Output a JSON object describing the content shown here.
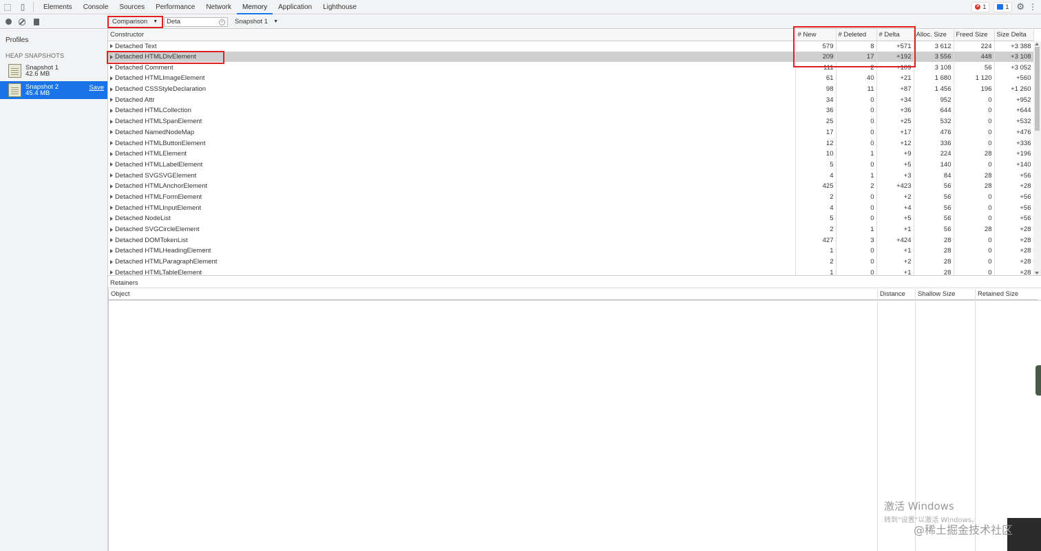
{
  "devtools": {
    "tabs": [
      "Elements",
      "Console",
      "Sources",
      "Performance",
      "Network",
      "Memory",
      "Application",
      "Lighthouse"
    ],
    "selected_tab": "Memory",
    "error_count": "1",
    "message_count": "1"
  },
  "profiles": {
    "title": "Profiles",
    "section": "HEAP SNAPSHOTS",
    "snapshots": [
      {
        "name": "Snapshot 1",
        "size": "42.6 MB"
      },
      {
        "name": "Snapshot 2",
        "size": "45.4 MB",
        "action": "Save"
      }
    ]
  },
  "toolbar": {
    "view_mode": "Comparison",
    "filter_value": "Deta",
    "compare_to": "Snapshot 1"
  },
  "grid": {
    "columns": [
      "Constructor",
      "# New",
      "# Deleted",
      "# Delta",
      "Alloc. Size",
      "Freed Size",
      "Size Delta"
    ],
    "selected_row": 1,
    "rows": [
      [
        "Detached Text",
        "579",
        "8",
        "+571",
        "3 612",
        "224",
        "+3 388"
      ],
      [
        "Detached HTMLDivElement",
        "209",
        "17",
        "+192",
        "3 556",
        "448",
        "+3 108"
      ],
      [
        "Detached Comment",
        "111",
        "2",
        "+109",
        "3 108",
        "56",
        "+3 052"
      ],
      [
        "Detached HTMLImageElement",
        "61",
        "40",
        "+21",
        "1 680",
        "1 120",
        "+560"
      ],
      [
        "Detached CSSStyleDeclaration",
        "98",
        "11",
        "+87",
        "1 456",
        "196",
        "+1 260"
      ],
      [
        "Detached Attr",
        "34",
        "0",
        "+34",
        "952",
        "0",
        "+952"
      ],
      [
        "Detached HTMLCollection",
        "36",
        "0",
        "+36",
        "644",
        "0",
        "+644"
      ],
      [
        "Detached HTMLSpanElement",
        "25",
        "0",
        "+25",
        "532",
        "0",
        "+532"
      ],
      [
        "Detached NamedNodeMap",
        "17",
        "0",
        "+17",
        "476",
        "0",
        "+476"
      ],
      [
        "Detached HTMLButtonElement",
        "12",
        "0",
        "+12",
        "336",
        "0",
        "+336"
      ],
      [
        "Detached HTMLElement",
        "10",
        "1",
        "+9",
        "224",
        "28",
        "+196"
      ],
      [
        "Detached HTMLLabelElement",
        "5",
        "0",
        "+5",
        "140",
        "0",
        "+140"
      ],
      [
        "Detached SVGSVGElement",
        "4",
        "1",
        "+3",
        "84",
        "28",
        "+56"
      ],
      [
        "Detached HTMLAnchorElement",
        "425",
        "2",
        "+423",
        "56",
        "28",
        "+28"
      ],
      [
        "Detached HTMLFormElement",
        "2",
        "0",
        "+2",
        "56",
        "0",
        "+56"
      ],
      [
        "Detached HTMLInputElement",
        "4",
        "0",
        "+4",
        "56",
        "0",
        "+56"
      ],
      [
        "Detached NodeList",
        "5",
        "0",
        "+5",
        "56",
        "0",
        "+56"
      ],
      [
        "Detached SVGCircleElement",
        "2",
        "1",
        "+1",
        "56",
        "28",
        "+28"
      ],
      [
        "Detached DOMTokenList",
        "427",
        "3",
        "+424",
        "28",
        "0",
        "+28"
      ],
      [
        "Detached HTMLHeadingElement",
        "1",
        "0",
        "+1",
        "28",
        "0",
        "+28"
      ],
      [
        "Detached HTMLParagraphElement",
        "2",
        "0",
        "+2",
        "28",
        "0",
        "+28"
      ],
      [
        "Detached HTMLTableElement",
        "1",
        "0",
        "+1",
        "28",
        "0",
        "+28"
      ]
    ]
  },
  "retainers": {
    "title": "Retainers",
    "columns": [
      "Object",
      "Distance",
      "Shallow Size",
      "Retained Size"
    ]
  },
  "watermark": {
    "line1": "激活 Windows",
    "line2": "转到\"设置\"以激活 Windows。",
    "line3": "@稀土掘金技术社区"
  },
  "colors": {
    "selection": "#1a73e8",
    "highlight_box": "#e02020"
  }
}
